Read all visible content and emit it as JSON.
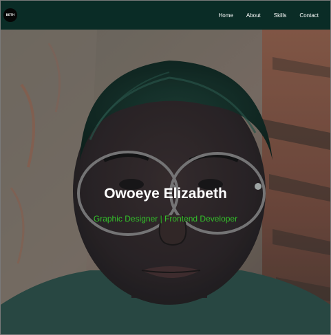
{
  "navbar": {
    "logo_text": "BETH",
    "links": [
      "Home",
      "About",
      "Skills",
      "Contact"
    ]
  },
  "hero": {
    "title": "Owoeye Elizabeth",
    "subtitle": "Graphic Designer | Frontend Developer",
    "subtitle_color": "#33c12a"
  },
  "colors": {
    "navbar_bg": "#0a2c26",
    "link": "#ffffff",
    "title": "#ffffff"
  }
}
